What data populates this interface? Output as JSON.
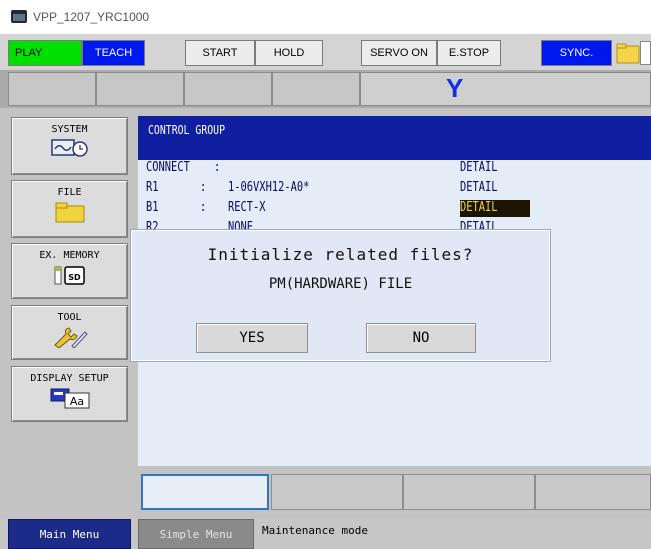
{
  "window": {
    "title": "VPP_1207_YRC1000"
  },
  "toolbar": {
    "play": "PLAY",
    "teach": "TEACH",
    "start": "START",
    "hold": "HOLD",
    "servo_on": "SERVO ON",
    "estop": "E.STOP",
    "sync": "SYNC."
  },
  "header": {
    "group_indicator": "Y"
  },
  "sidebar": {
    "items": [
      {
        "label": "SYSTEM",
        "icon": "system-monitor-clock-icon"
      },
      {
        "label": "FILE",
        "icon": "folder-icon"
      },
      {
        "label": "EX. MEMORY",
        "icon": "sd-card-icon"
      },
      {
        "label": "TOOL",
        "icon": "tool-icon"
      },
      {
        "label": "DISPLAY SETUP",
        "icon": "display-setup-icon"
      }
    ]
  },
  "panel": {
    "title": "CONTROL GROUP",
    "rows": [
      {
        "key": "CONNECT",
        "value": "",
        "action": "DETAIL"
      },
      {
        "key": "R1",
        "value": "1-06VXH12-A0*",
        "action": "DETAIL"
      },
      {
        "key": "B1",
        "value": "RECT-X",
        "action": "DETAIL"
      },
      {
        "key": "R2",
        "value": "NONE",
        "action": "DETAIL"
      }
    ],
    "row_sep": ":"
  },
  "dialog": {
    "question": "Initialize related files?",
    "file": "PM(HARDWARE) FILE",
    "yes": "YES",
    "no": "NO"
  },
  "statusbar": {
    "main_menu": "Main Menu",
    "simple_menu": "Simple Menu",
    "mode": "Maintenance mode"
  },
  "colors": {
    "play": "#00e000",
    "teach": "#0018f0",
    "panel_title_bg": "#0f1fa0",
    "main_menu_bg": "#1c2a88"
  }
}
